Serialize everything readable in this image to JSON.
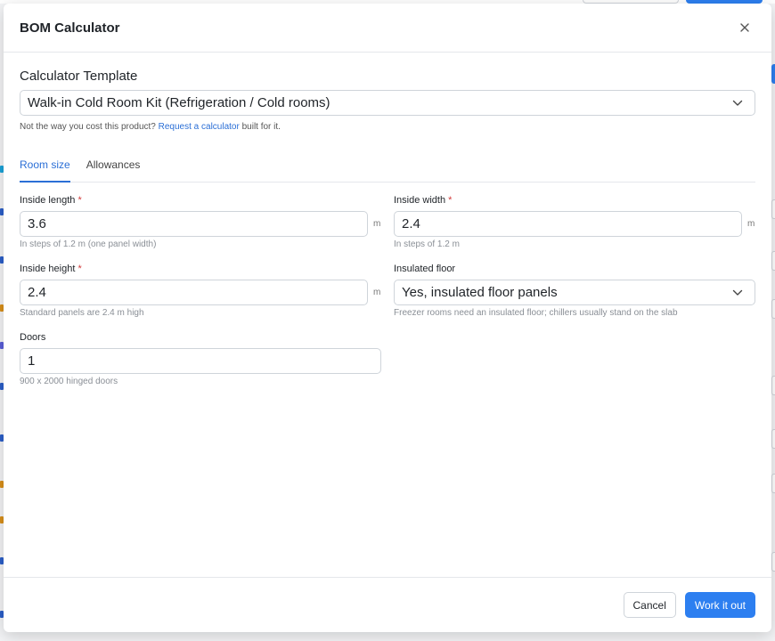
{
  "modal": {
    "title": "BOM Calculator"
  },
  "template": {
    "label": "Calculator Template",
    "selected": "Walk-in Cold Room Kit (Refrigeration / Cold rooms)",
    "hint_prefix": "Not the way you cost this product?",
    "hint_link": "Request a calculator",
    "hint_suffix": "built for it."
  },
  "tabs": [
    {
      "label": "Room size",
      "active": true
    },
    {
      "label": "Allowances",
      "active": false
    }
  ],
  "fields": {
    "inside_length": {
      "label": "Inside length",
      "required": "*",
      "value": "3.6",
      "unit": "m",
      "hint": "In steps of 1.2 m (one panel width)"
    },
    "inside_width": {
      "label": "Inside width",
      "required": "*",
      "value": "2.4",
      "unit": "m",
      "hint": "In steps of 1.2 m"
    },
    "inside_height": {
      "label": "Inside height",
      "required": "*",
      "value": "2.4",
      "unit": "m",
      "hint": "Standard panels are 2.4 m high"
    },
    "insulated_floor": {
      "label": "Insulated floor",
      "value": "Yes, insulated floor panels",
      "hint": "Freezer rooms need an insulated floor; chillers usually stand on the slab"
    },
    "doors": {
      "label": "Doors",
      "value": "1",
      "hint": "900 x 2000 hinged doors"
    }
  },
  "footer": {
    "cancel_label": "Cancel",
    "submit_label": "Work it out"
  },
  "colors": {
    "accent": "#2d7ff0",
    "link": "#2b6fd6",
    "required": "#d23b3b"
  }
}
